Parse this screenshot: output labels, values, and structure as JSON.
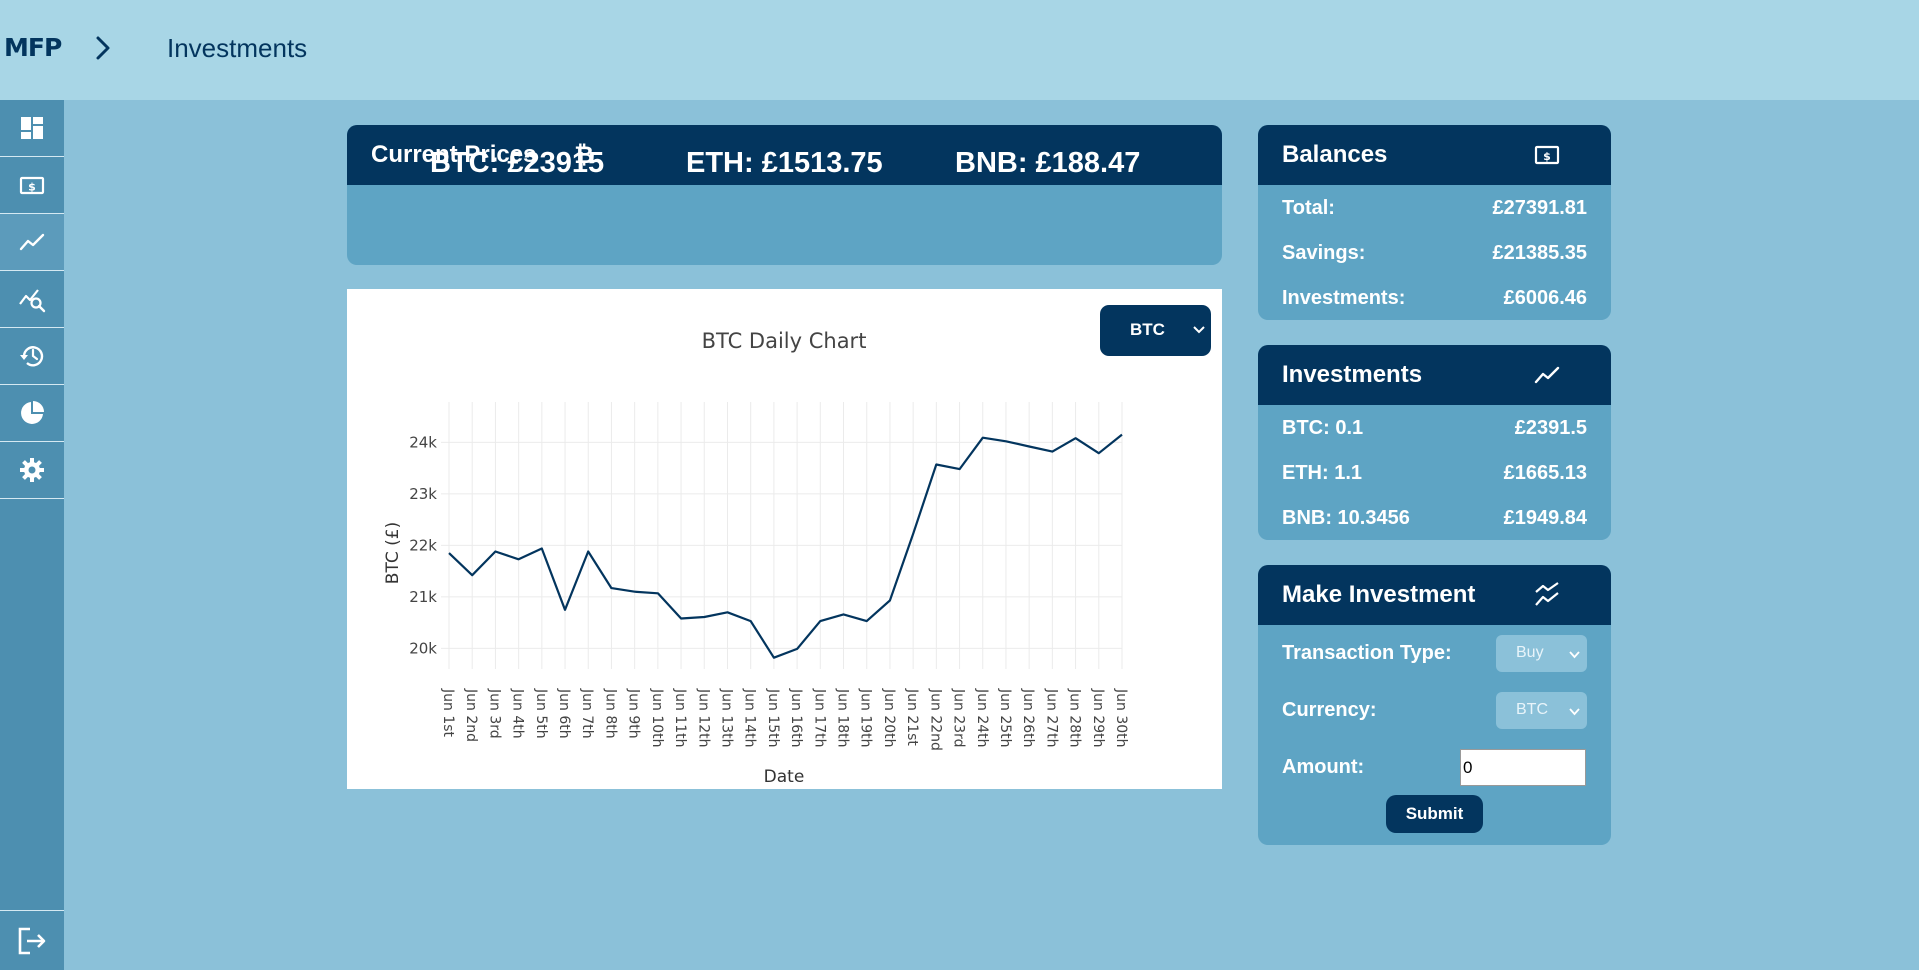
{
  "app": {
    "logo": "MFP",
    "page_title": "Investments"
  },
  "sidebar": {
    "items": [
      {
        "icon": "dashboard-icon"
      },
      {
        "icon": "cash-icon"
      },
      {
        "icon": "trend-line-icon",
        "active": true
      },
      {
        "icon": "chart-search-icon"
      },
      {
        "icon": "history-icon"
      },
      {
        "icon": "pie-chart-icon"
      },
      {
        "icon": "gear-icon"
      }
    ],
    "logout_icon": "logout-icon"
  },
  "current_prices": {
    "title": "Current Prices",
    "icon": "bitcoin-icon",
    "btc": "BTC:  £23915",
    "eth": "ETH:  £1513.75",
    "bnb": "BNB:  £188.47"
  },
  "chart_controls": {
    "currency_selected": "BTC"
  },
  "chart_data": {
    "type": "line",
    "title": "BTC Daily Chart",
    "xlabel": "Date",
    "ylabel": "BTC (£)",
    "x": [
      "Jun 1st",
      "Jun 2nd",
      "Jun 3rd",
      "Jun 4th",
      "Jun 5th",
      "Jun 6th",
      "Jun 7th",
      "Jun 8th",
      "Jun 9th",
      "Jun 10th",
      "Jun 11th",
      "Jun 12th",
      "Jun 13th",
      "Jun 14th",
      "Jun 15th",
      "Jun 16th",
      "Jun 17th",
      "Jun 18th",
      "Jun 19th",
      "Jun 20th",
      "Jun 21st",
      "Jun 22nd",
      "Jun 23rd",
      "Jun 24th",
      "Jun 25th",
      "Jun 26th",
      "Jun 27th",
      "Jun 28th",
      "Jun 29th",
      "Jun 30th"
    ],
    "values": [
      21850,
      21420,
      21880,
      21730,
      21940,
      20750,
      21880,
      21170,
      21100,
      21070,
      20580,
      20610,
      20700,
      20530,
      19820,
      19990,
      20530,
      20660,
      20530,
      20930,
      22220,
      23570,
      23480,
      24090,
      24020,
      23920,
      23820,
      24080,
      23790,
      24150
    ],
    "yticks": [
      20000,
      21000,
      22000,
      23000,
      24000
    ],
    "ytick_labels": [
      "20k",
      "21k",
      "22k",
      "23k",
      "24k"
    ],
    "ylim": [
      19600,
      24550
    ],
    "grid": true,
    "color": "#03355e"
  },
  "balances": {
    "title": "Balances",
    "icon": "cash-icon",
    "rows": [
      {
        "label": "Total:",
        "value": "£27391.81"
      },
      {
        "label": "Savings:",
        "value": "£21385.35"
      },
      {
        "label": "Investments:",
        "value": "£6006.46"
      }
    ]
  },
  "investments": {
    "title": "Investments",
    "icon": "trend-line-icon",
    "rows": [
      {
        "label": "BTC: 0.1",
        "value": "£2391.5"
      },
      {
        "label": "ETH: 1.1",
        "value": "£1665.13"
      },
      {
        "label": "BNB: 10.3456",
        "value": "£1949.84"
      }
    ]
  },
  "make_investment": {
    "title": "Make Investment",
    "icon": "double-trend-icon",
    "transaction_type_label": "Transaction Type:",
    "transaction_type_value": "Buy",
    "currency_label": "Currency:",
    "currency_value": "BTC",
    "amount_label": "Amount:",
    "amount_value": "0",
    "submit_label": "Submit"
  },
  "colors": {
    "navy": "#03355e",
    "background": "#8bc1d9",
    "topbar": "#a8d6e6",
    "card_body": "#5ea4c4"
  }
}
